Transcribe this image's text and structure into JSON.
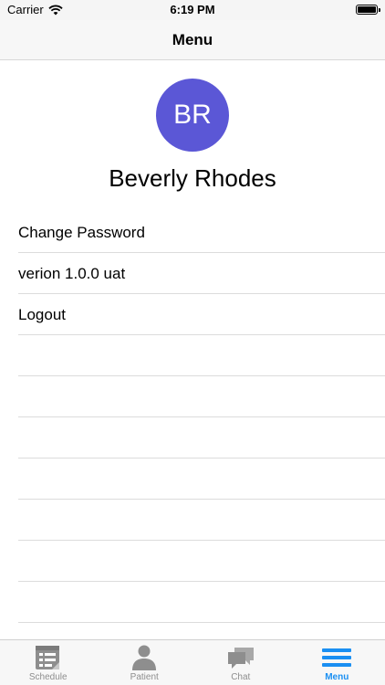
{
  "status_bar": {
    "carrier": "Carrier",
    "time": "6:19 PM",
    "battery_level": 1.0
  },
  "nav": {
    "title": "Menu"
  },
  "profile": {
    "initials": "BR",
    "name": "Beverly Rhodes",
    "avatar_color": "#5b57d6"
  },
  "menu": {
    "items": [
      {
        "label": "Change Password"
      },
      {
        "label": "verion 1.0.0 uat"
      },
      {
        "label": "Logout"
      }
    ]
  },
  "tabs": [
    {
      "label": "Schedule",
      "icon": "schedule-icon",
      "active": false
    },
    {
      "label": "Patient",
      "icon": "person-icon",
      "active": false
    },
    {
      "label": "Chat",
      "icon": "chat-icon",
      "active": false
    },
    {
      "label": "Menu",
      "icon": "hamburger-menu-icon",
      "active": true
    }
  ],
  "colors": {
    "accent": "#1a8ff2",
    "inactive_tab": "#8e8e8e"
  }
}
